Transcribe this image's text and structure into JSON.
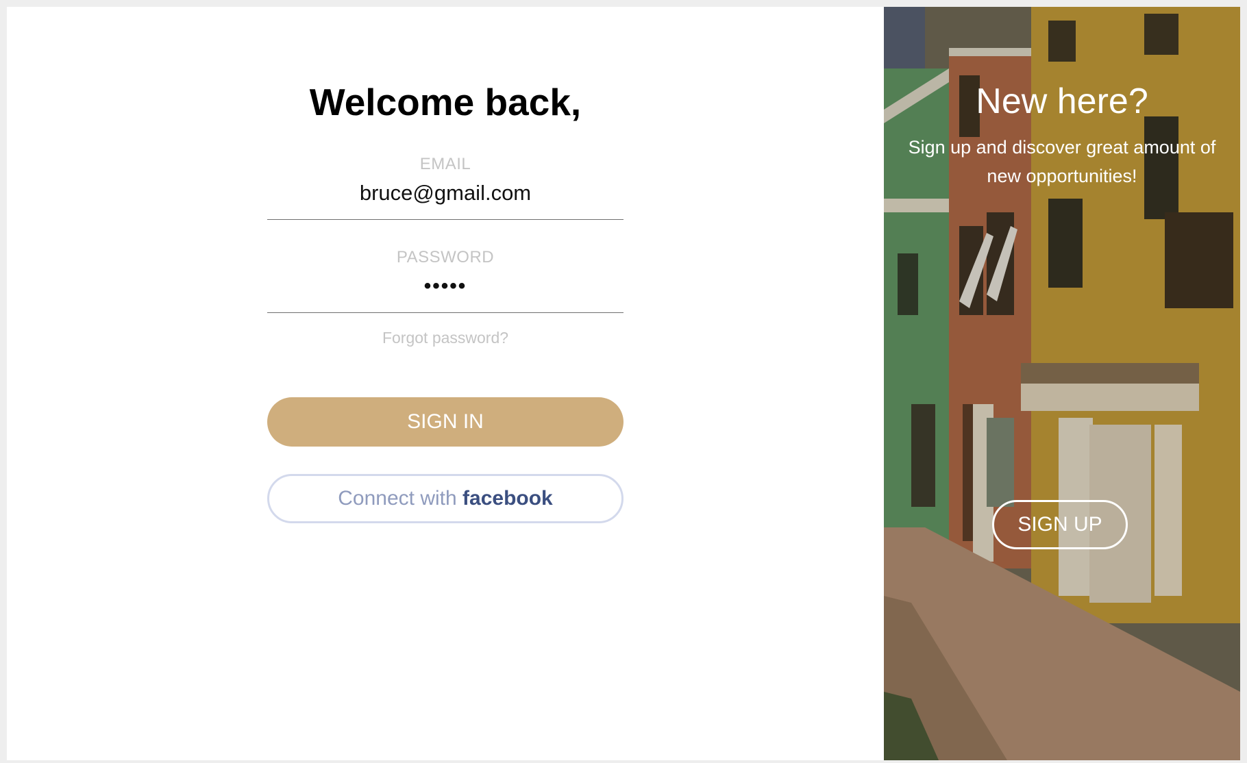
{
  "signin": {
    "title": "Welcome back,",
    "email": {
      "label": "EMAIL",
      "value": "bruce@gmail.com"
    },
    "password": {
      "label": "PASSWORD",
      "value": "•••••"
    },
    "forgot_password": "Forgot password?",
    "signin_button": "SIGN IN",
    "facebook_button": {
      "prefix": "Connect with",
      "brand": "facebook"
    }
  },
  "signup": {
    "title": "New here?",
    "text": "Sign up and discover great amount of new opportunities!",
    "signup_button": "SIGN UP"
  },
  "colors": {
    "accent": "#cfae7d",
    "facebook_brand": "#3b4f80",
    "facebook_border": "#d3d9ec",
    "label_gray": "#c4c4c4"
  }
}
